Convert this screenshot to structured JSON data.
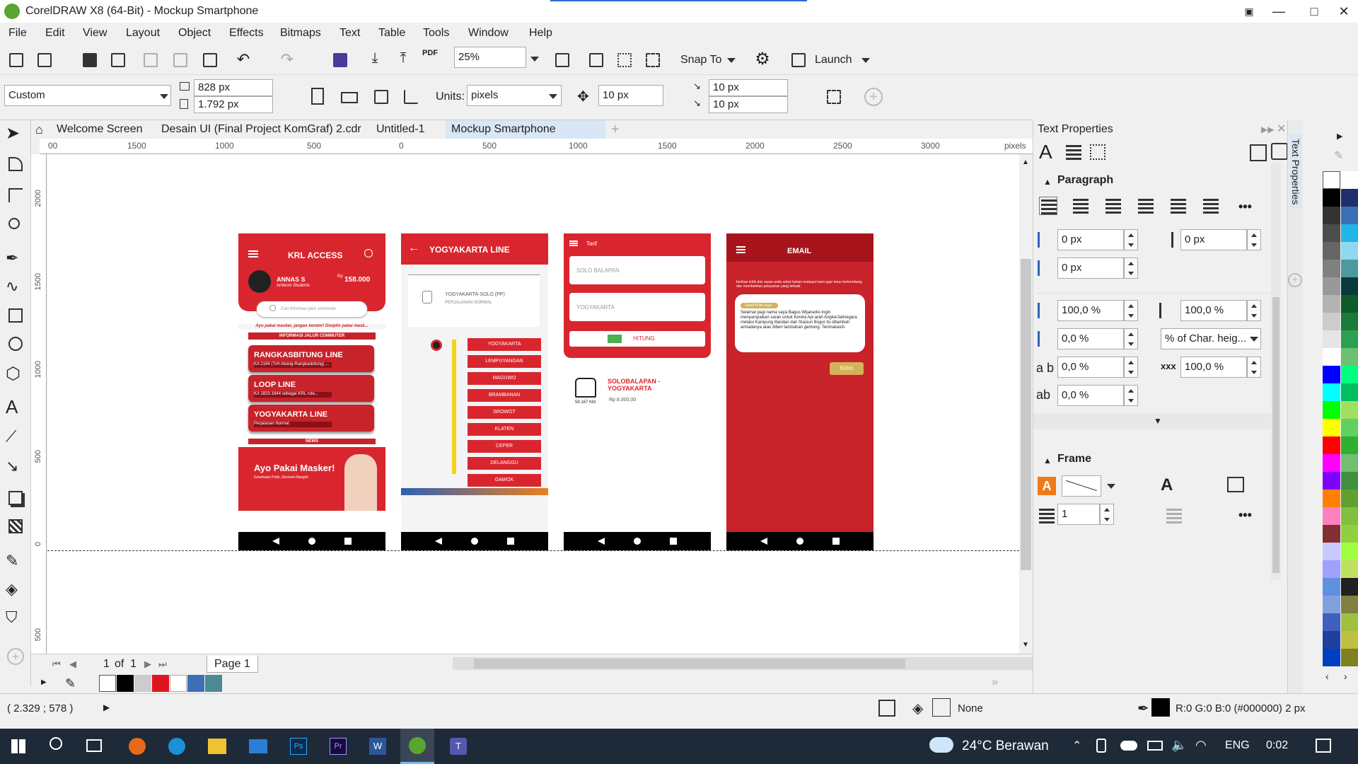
{
  "window": {
    "title": "CorelDRAW X8 (64-Bit) - Mockup Smartphone",
    "min": "—",
    "max": "□",
    "close": "✕"
  },
  "menu": [
    "File",
    "Edit",
    "View",
    "Layout",
    "Object",
    "Effects",
    "Bitmaps",
    "Text",
    "Table",
    "Tools",
    "Window",
    "Help"
  ],
  "toolbar1": {
    "zoom": "25%",
    "snap_to": "Snap To",
    "launch": "Launch",
    "pdf": "PDF"
  },
  "toolbar2": {
    "preset": "Custom",
    "width": "828 px",
    "height": "1.792 px",
    "units_label": "Units:",
    "units": "pixels",
    "nudge": "10 px",
    "dup_x": "10 px",
    "dup_y": "10 px"
  },
  "doc_tabs": [
    "Welcome Screen",
    "Desain UI (Final Project KomGraf) 2.cdr",
    "Untitled-1",
    "Mockup Smartphone"
  ],
  "ruler_h": [
    "00",
    "1500",
    "1000",
    "500",
    "0",
    "500",
    "1000",
    "1500",
    "2000",
    "2500",
    "3000",
    "pixels"
  ],
  "ruler_v": [
    "2000",
    "1500",
    "1000",
    "500",
    "0",
    "500"
  ],
  "pages": {
    "current": "1",
    "of_label": "of",
    "total": "1",
    "tab": "Page 1"
  },
  "status": {
    "coords": "( 2.329 ; 578  )",
    "fill": "None",
    "outline": "R:0 G:0 B:0 (#000000)  2 px"
  },
  "taskbar": {
    "weather": "24°C  Berawan",
    "lang": "ENG",
    "time": "0:02"
  },
  "docker": {
    "title": "Text Properties",
    "side_tab": "Text Properties",
    "paragraph": {
      "label": "Paragraph",
      "left_indent": "0 px",
      "right_indent": "0 px",
      "first_line": "0 px",
      "line_spacing": "100,0 %",
      "char_spacing": "100,0 %",
      "before": "0,0 %",
      "spacing_unit": "% of Char. heig...",
      "word_spacing": "0,0 %",
      "lang_spacing": "100,0 %",
      "language": "0,0 %"
    },
    "frame": {
      "label": "Frame",
      "columns": "1"
    }
  },
  "phone1": {
    "title": "KRL ACCESS",
    "user": "ANNAS S",
    "user_sub": "Amikom Students",
    "rp": "Rp",
    "balance": "158.000",
    "search": "Cari informasi jalur commuter",
    "ticker": "Ayo pakai masker, jangan kendor! Disiplin pakai mask...",
    "section": "INFORMASI JALUR COMMUTER",
    "lines": [
      {
        "name": "RANGKASBITUNG LINE",
        "sub": "KA 2184 (Tnh Abang-Rangkasbitung) ..."
      },
      {
        "name": "LOOP LINE",
        "sub": "KA 1823-1844 sebagai KRL rute..."
      },
      {
        "name": "YOGYAKARTA LINE",
        "sub": "Perjalanan Normal"
      }
    ],
    "news": "NEWS",
    "banner": "Ayo Pakai Masker!",
    "banner_sub": "Kesehatan Pulih, Ekonomi Bangkit"
  },
  "phone2": {
    "title": "YOGYAKARTA LINE",
    "route": "YOGYAKARTA-SOLO (PP)",
    "route_sub": "PERJALANAN NORMAL",
    "stations": [
      "YOGYAKARTA",
      "LEMPUYANGAN",
      "MAGUWO",
      "BRAMBANAN",
      "SROWOT",
      "KLATEN",
      "CEPER",
      "DELANGGU",
      "GAWOK"
    ]
  },
  "phone3": {
    "title": "Tarif",
    "from": "SOLO BALAPAN",
    "to": "YOGYAKARTA",
    "button": "HITUNG",
    "result": "SOLOBALAPAN - YOGYAKARTA",
    "distance": "59.167 KM",
    "price": "Rp 8.000,00"
  },
  "phone4": {
    "title": "EMAIL",
    "intro": "berikan kritik dan saran anda untuk bahan evaluasi kami agar terus berkembang dan memberikan pelayanan yang terbaik.",
    "label": "Saran/Kritik saya :",
    "message": "Selamat pagi nama saya Bagus Wijanarko ingin menyampaikan saran untuk Kereta Api arah Angke/Jatinegara melalui Kampung Bandan dari Stasiun Bogor itu ditambah armadanya atau diberi tambahan gerbong. Terimakasih.",
    "send": "Kirim"
  },
  "colors": {
    "accent_red": "#d9262e",
    "dark_red": "#c8222a",
    "ui_bg": "#f0f0f0",
    "taskbar": "#1f2a38"
  },
  "palette": [
    "#000000",
    "#ffffff",
    "#d9262e",
    "#3b6fb6",
    "#2b9d8f"
  ],
  "color_swatches": [
    "none",
    "#ffffff",
    "#000000",
    "#1f2f6b",
    "#333333",
    "#3a6eb5",
    "#4d4d4d",
    "#22b5e8",
    "#666666",
    "#8fd8f0",
    "#808080",
    "#4a9aa0",
    "#999999",
    "#0a3a3a",
    "#b3b3b3",
    "#0d5a2a",
    "#cccccc",
    "#1a7a3a",
    "#e6e6e6",
    "#2aa050",
    "#ffffff",
    "#6cc070",
    "#0000ff",
    "#00ff80",
    "#00ffff",
    "#00c060",
    "#00ff00",
    "#a0e060",
    "#ffff00",
    "#60d060",
    "#ff0000",
    "#30b030",
    "#ff00ff",
    "#70c070",
    "#8000ff",
    "#409040",
    "#ff8000",
    "#60a030",
    "#ff80c0",
    "#80c040",
    "#803030",
    "#90d040",
    "#c8c8ff",
    "#a0ff40",
    "#a0a0ff",
    "#c0e060",
    "#6090e0",
    "#202020",
    "#80a0e0",
    "#808040",
    "#4060c0",
    "#a0c040",
    "#2040a0",
    "#c0c040",
    "#0040c0",
    "#808020"
  ]
}
